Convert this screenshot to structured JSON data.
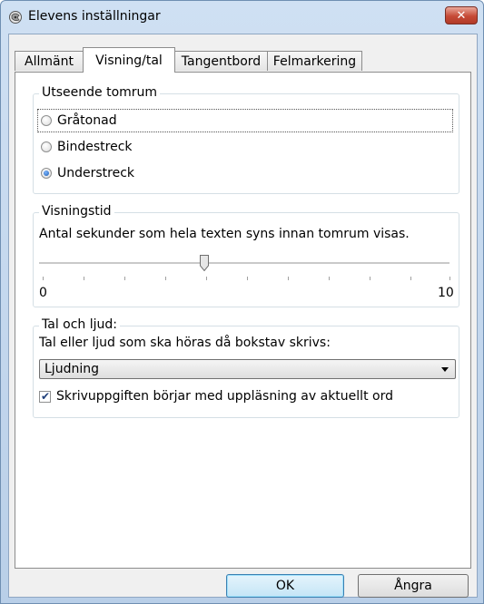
{
  "window": {
    "title": "Elevens inställningar",
    "close_glyph": "✕"
  },
  "tabs": [
    {
      "label": "Allmänt",
      "active": false
    },
    {
      "label": "Visning/tal",
      "active": true
    },
    {
      "label": "Tangentbord",
      "active": false
    },
    {
      "label": "Felmarkering",
      "active": false
    }
  ],
  "appearance_group": {
    "label": "Utseende tomrum",
    "options": [
      {
        "label": "Gråtonad",
        "selected": false
      },
      {
        "label": "Bindestreck",
        "selected": false
      },
      {
        "label": "Understreck",
        "selected": true
      }
    ]
  },
  "display_time_group": {
    "label": "Visningstid",
    "description": "Antal sekunder som hela texten syns innan tomrum visas.",
    "slider_min": "0",
    "slider_max": "10",
    "slider_value": 4
  },
  "sound_group": {
    "label": "Tal och ljud:",
    "description": "Tal eller ljud som ska höras då bokstav skrivs:",
    "select_value": "Ljudning",
    "checkbox_label": "Skrivuppgiften börjar med uppläsning av aktuellt ord",
    "checkbox_checked": true
  },
  "buttons": {
    "ok": "OK",
    "cancel": "Ångra"
  }
}
